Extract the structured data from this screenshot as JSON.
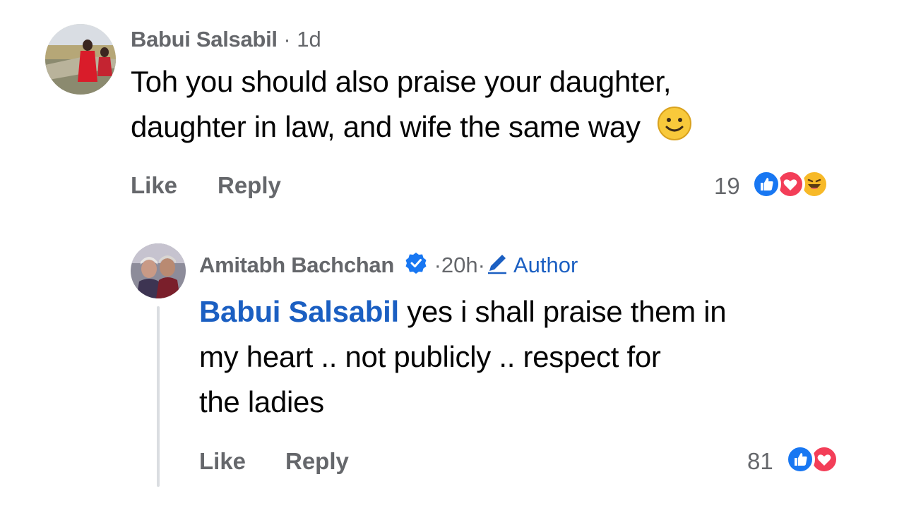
{
  "comments": [
    {
      "author": "Babui Salsabil",
      "time": "1d",
      "text_line1": "Toh you should also praise your daughter,",
      "text_line2": "daughter in law, and wife the same way",
      "like_label": "Like",
      "reply_label": "Reply",
      "reaction_count": "19",
      "reactions": [
        "like-reaction-icon",
        "love-reaction-icon",
        "haha-reaction-icon"
      ]
    },
    {
      "author": "Amitabh Bachchan",
      "time": "20h",
      "badge_label": "Author",
      "mention": "Babui Salsabil",
      "text_line1": "yes i shall praise them in",
      "text_line2": "my heart .. not publicly .. respect for",
      "text_line3": "the ladies",
      "like_label": "Like",
      "reply_label": "Reply",
      "reaction_count": "81",
      "reactions": [
        "like-reaction-icon",
        "love-reaction-icon"
      ]
    }
  ],
  "colors": {
    "meta_gray": "#65676b",
    "link_blue": "#1b5fc2",
    "like_blue": "#1877f2",
    "love_red": "#f33e58"
  }
}
